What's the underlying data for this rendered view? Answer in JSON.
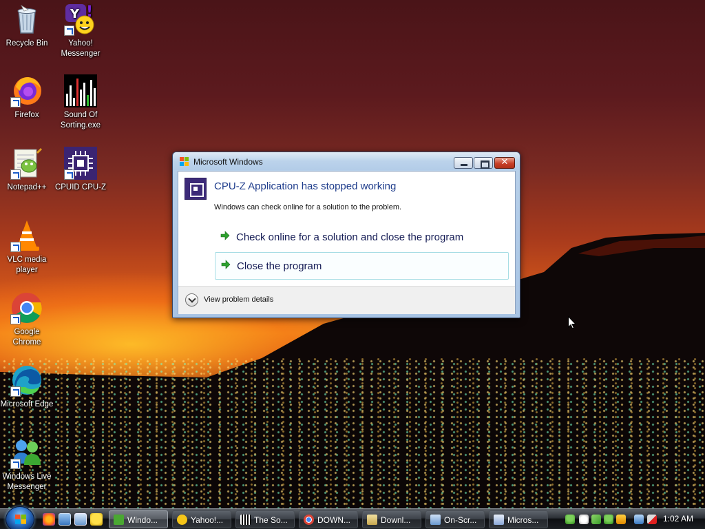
{
  "desktop": {
    "icons": [
      {
        "label": "Recycle Bin",
        "icon": "recycle-bin-icon"
      },
      {
        "label": "Yahoo! Messenger",
        "icon": "yahoo-messenger-icon"
      },
      {
        "label": "Firefox",
        "icon": "firefox-icon"
      },
      {
        "label": "Sound Of Sorting.exe",
        "icon": "sound-of-sorting-icon"
      },
      {
        "label": "Notepad++",
        "icon": "notepad-plus-plus-icon"
      },
      {
        "label": "CPUID CPU-Z",
        "icon": "cpu-z-icon"
      },
      {
        "label": "VLC media player",
        "icon": "vlc-icon"
      },
      {
        "label": "Google Chrome",
        "icon": "chrome-icon"
      },
      {
        "label": "Microsoft Edge",
        "icon": "edge-icon"
      },
      {
        "label": "Windows Live Messenger",
        "icon": "windows-live-messenger-icon"
      }
    ]
  },
  "dialog": {
    "title": "Microsoft Windows",
    "main_instruction": "CPU-Z Application has stopped working",
    "content": "Windows can check online for a solution to the problem.",
    "commands": [
      {
        "label": "Check online for a solution and close the program"
      },
      {
        "label": "Close the program"
      }
    ],
    "details_label": "View problem details",
    "close_glyph": "✕"
  },
  "taskbar": {
    "tasks": [
      {
        "label": "Windo...",
        "icon": "windows-live-messenger-icon",
        "color": "#4aa832"
      },
      {
        "label": "Yahoo!...",
        "icon": "yahoo-messenger-icon",
        "color": "#f5c518"
      },
      {
        "label": "The So...",
        "icon": "sound-of-sorting-icon",
        "color": "#222222"
      },
      {
        "label": "DOWN...",
        "icon": "chrome-icon",
        "color": "#db4437"
      },
      {
        "label": "Downl...",
        "icon": "folder-icon",
        "color": "#d8c070"
      },
      {
        "label": "On-Scr...",
        "icon": "on-screen-keyboard-icon",
        "color": "#8ab4e8"
      },
      {
        "label": "Micros...",
        "icon": "windows-error-icon",
        "color": "#6a8cc8"
      }
    ],
    "clock": "1:02 AM"
  },
  "colors": {
    "accent_link": "#1f3d8c",
    "titlebar": "#b9d1ea",
    "command_arrow": "#2ea12e"
  }
}
